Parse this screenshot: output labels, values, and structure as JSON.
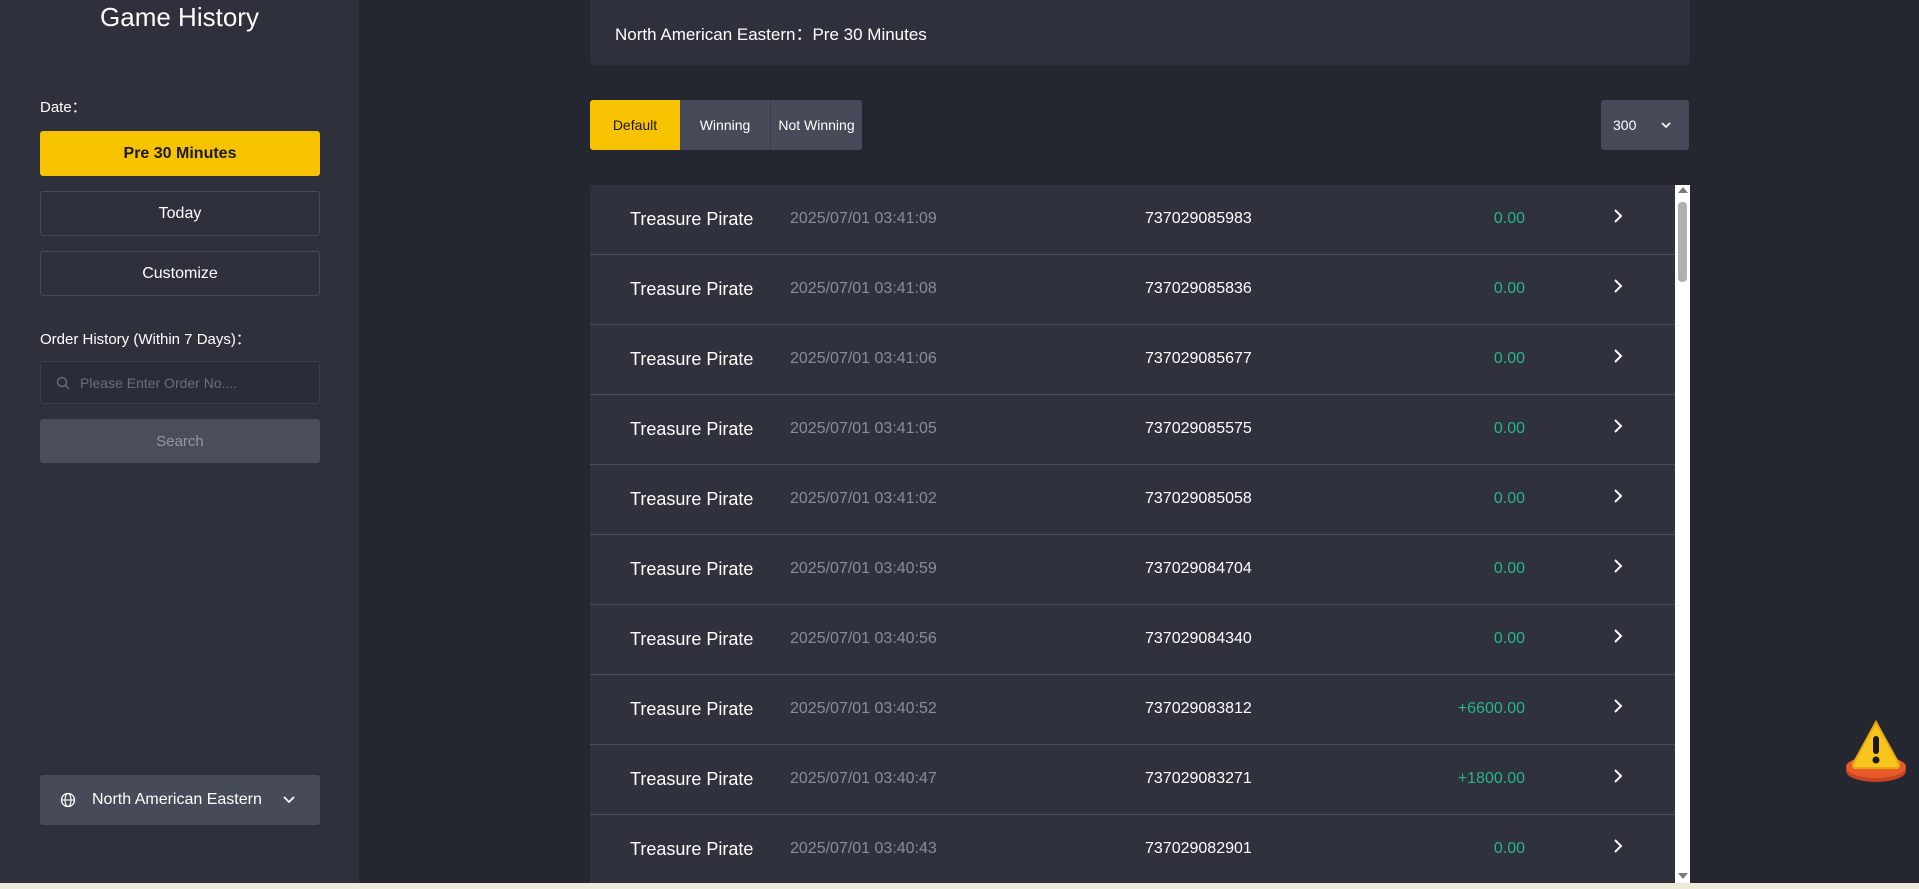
{
  "sidebar": {
    "title": "Game History",
    "date_label": "Date：",
    "date_options": [
      "Pre 30 Minutes",
      "Today",
      "Customize"
    ],
    "order_history_label": "Order History (Within 7 Days)：",
    "search_placeholder": "Please Enter Order No....",
    "search_button": "Search",
    "region": "North American Eastern"
  },
  "header": {
    "text": "North American Eastern：Pre 30 Minutes"
  },
  "filters": {
    "default": "Default",
    "winning": "Winning",
    "not_winning": "Not Winning",
    "count": "300"
  },
  "records": [
    {
      "game": "Treasure Pirate",
      "time": "2025/07/01 03:41:09",
      "order": "737029085983",
      "amount": "0.00"
    },
    {
      "game": "Treasure Pirate",
      "time": "2025/07/01 03:41:08",
      "order": "737029085836",
      "amount": "0.00"
    },
    {
      "game": "Treasure Pirate",
      "time": "2025/07/01 03:41:06",
      "order": "737029085677",
      "amount": "0.00"
    },
    {
      "game": "Treasure Pirate",
      "time": "2025/07/01 03:41:05",
      "order": "737029085575",
      "amount": "0.00"
    },
    {
      "game": "Treasure Pirate",
      "time": "2025/07/01 03:41:02",
      "order": "737029085058",
      "amount": "0.00"
    },
    {
      "game": "Treasure Pirate",
      "time": "2025/07/01 03:40:59",
      "order": "737029084704",
      "amount": "0.00"
    },
    {
      "game": "Treasure Pirate",
      "time": "2025/07/01 03:40:56",
      "order": "737029084340",
      "amount": "0.00"
    },
    {
      "game": "Treasure Pirate",
      "time": "2025/07/01 03:40:52",
      "order": "737029083812",
      "amount": "+6600.00"
    },
    {
      "game": "Treasure Pirate",
      "time": "2025/07/01 03:40:47",
      "order": "737029083271",
      "amount": "+1800.00"
    },
    {
      "game": "Treasure Pirate",
      "time": "2025/07/01 03:40:43",
      "order": "737029082901",
      "amount": "0.00"
    }
  ],
  "colors": {
    "accent": "#f7c200",
    "amount": "#27b589"
  },
  "icons": [
    "search-icon",
    "globe-icon",
    "chevron-down-icon",
    "chevron-right-icon",
    "warning-icon"
  ]
}
